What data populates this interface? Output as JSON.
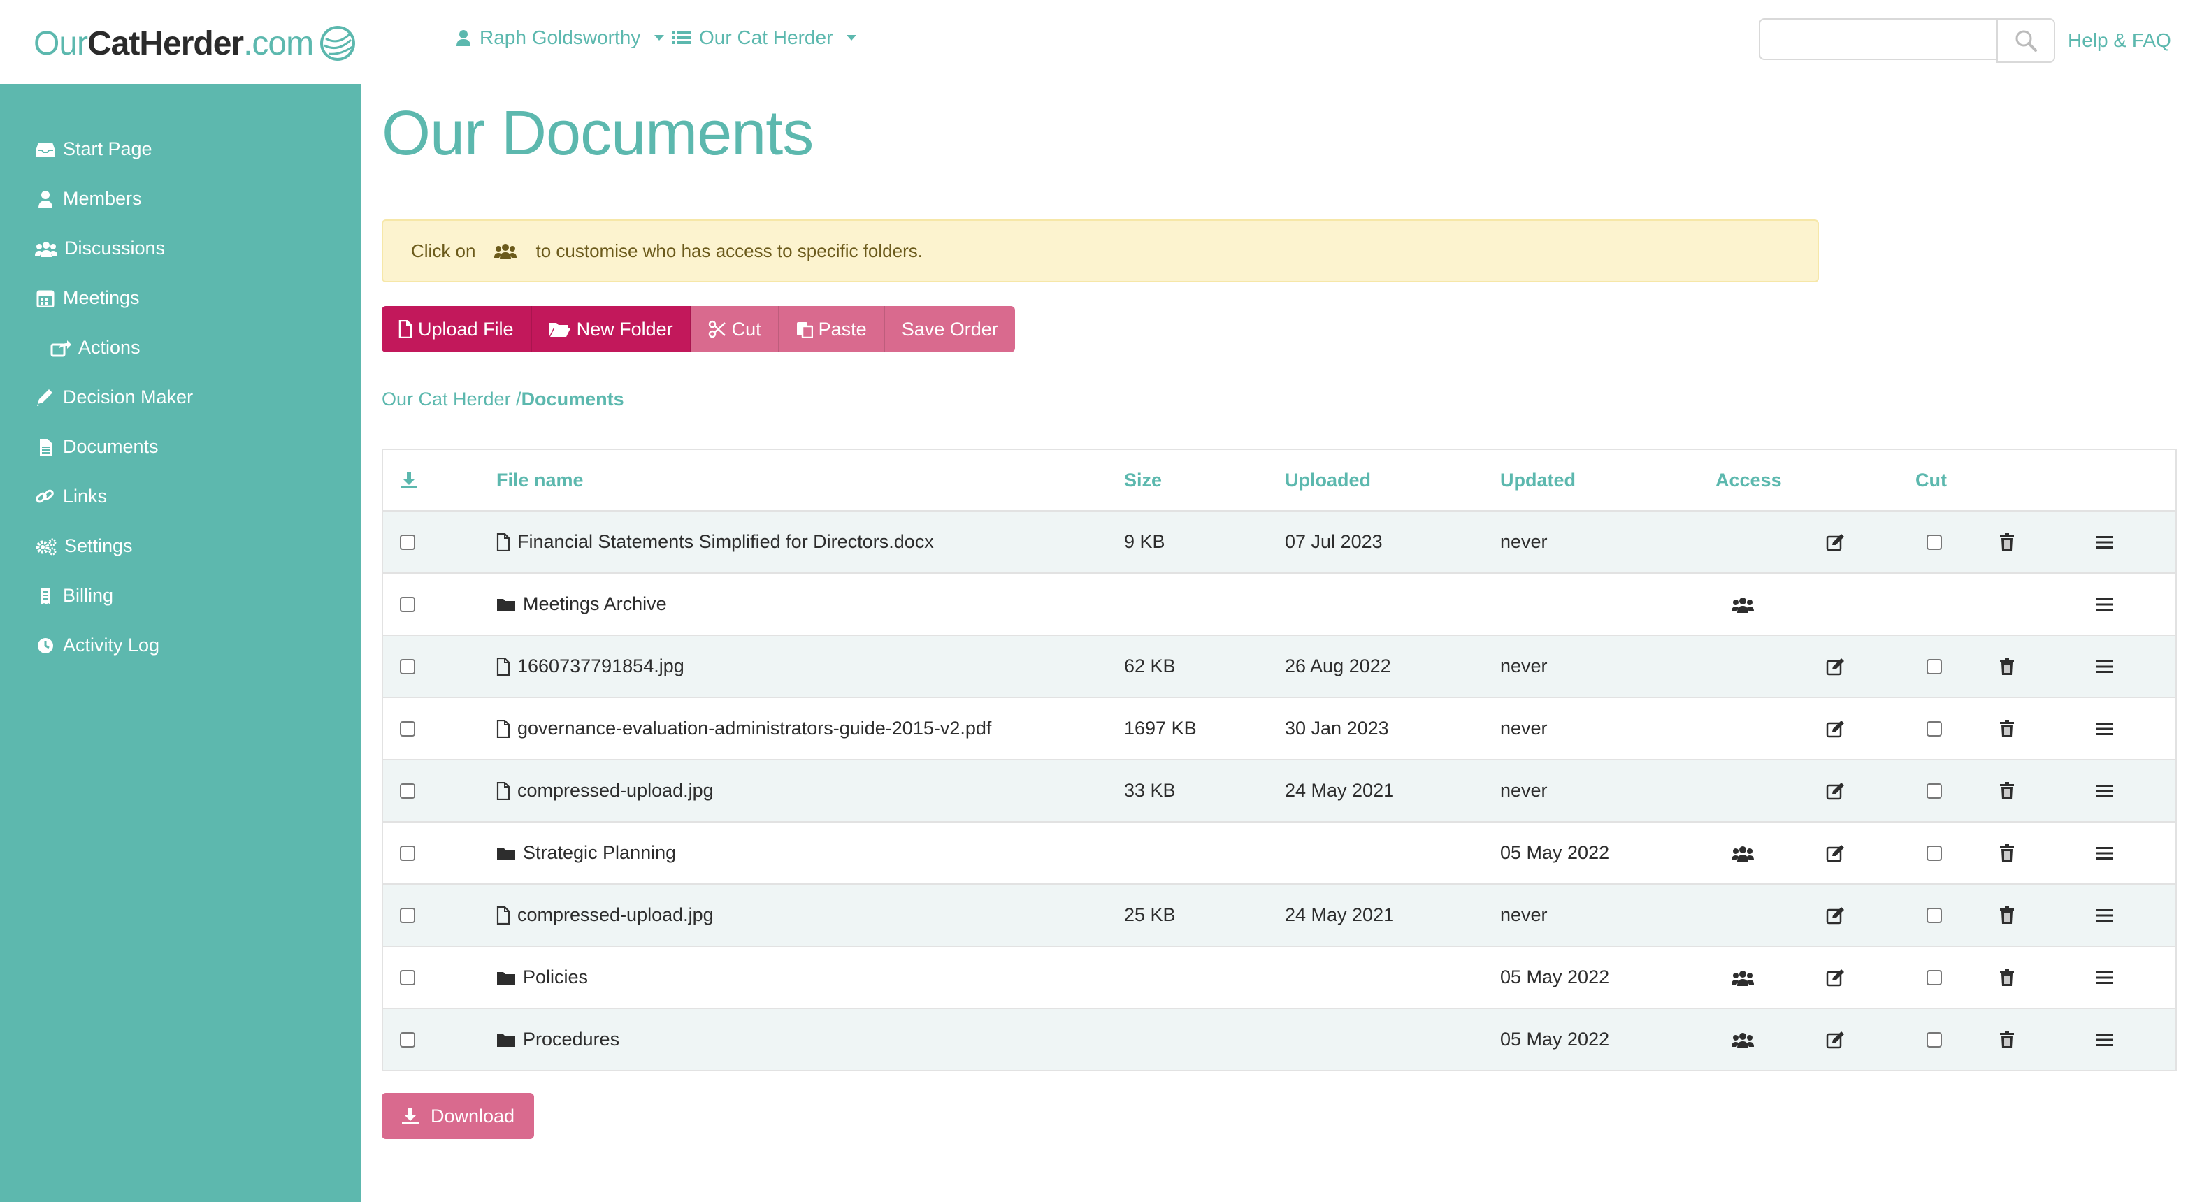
{
  "brand": {
    "part1": "Our",
    "part2": "CatHerder",
    "part3": ".com"
  },
  "topnav": {
    "user": "Raph Goldsworthy",
    "org": "Our Cat Herder",
    "help": "Help & FAQ",
    "search_placeholder": ""
  },
  "sidebar": {
    "items": [
      {
        "label": "Start Page",
        "icon": "inbox-icon"
      },
      {
        "label": "Members",
        "icon": "user-icon"
      },
      {
        "label": "Discussions",
        "icon": "users-icon"
      },
      {
        "label": "Meetings",
        "icon": "calendar-icon"
      },
      {
        "label": "Actions",
        "icon": "share-icon"
      },
      {
        "label": "Decision Maker",
        "icon": "pencil-icon"
      },
      {
        "label": "Documents",
        "icon": "file-icon"
      },
      {
        "label": "Links",
        "icon": "link-icon"
      },
      {
        "label": "Settings",
        "icon": "cogs-icon"
      },
      {
        "label": "Billing",
        "icon": "receipt-icon"
      },
      {
        "label": "Activity Log",
        "icon": "clock-icon"
      }
    ]
  },
  "page": {
    "title": "Our Documents"
  },
  "alert": {
    "prefix": "Click on",
    "suffix": "to customise who has access to specific folders."
  },
  "toolbar": {
    "upload": "Upload File",
    "new_folder": "New Folder",
    "cut": "Cut",
    "paste": "Paste",
    "save_order": "Save Order"
  },
  "breadcrumb": {
    "root": "Our Cat Herder /",
    "current": "Documents"
  },
  "table": {
    "headers": {
      "filename": "File name",
      "size": "Size",
      "uploaded": "Uploaded",
      "updated": "Updated",
      "access": "Access",
      "cut": "Cut"
    },
    "rows": [
      {
        "type": "file",
        "name": "Financial Statements Simplified for Directors.docx",
        "size": "9 KB",
        "uploaded": "07 Jul 2023",
        "updated": "never",
        "access": false,
        "edit": true,
        "cut": true,
        "delete": true
      },
      {
        "type": "folder",
        "name": "Meetings Archive",
        "size": "",
        "uploaded": "",
        "updated": "",
        "access": true,
        "edit": false,
        "cut": false,
        "delete": false
      },
      {
        "type": "file",
        "name": "1660737791854.jpg",
        "size": "62 KB",
        "uploaded": "26 Aug 2022",
        "updated": "never",
        "access": false,
        "edit": true,
        "cut": true,
        "delete": true
      },
      {
        "type": "file",
        "name": "governance-evaluation-administrators-guide-2015-v2.pdf",
        "size": "1697 KB",
        "uploaded": "30 Jan 2023",
        "updated": "never",
        "access": false,
        "edit": true,
        "cut": true,
        "delete": true
      },
      {
        "type": "file",
        "name": "compressed-upload.jpg",
        "size": "33 KB",
        "uploaded": "24 May 2021",
        "updated": "never",
        "access": false,
        "edit": true,
        "cut": true,
        "delete": true
      },
      {
        "type": "folder",
        "name": "Strategic Planning",
        "size": "",
        "uploaded": "",
        "updated": "05 May 2022",
        "access": true,
        "edit": true,
        "cut": true,
        "delete": true
      },
      {
        "type": "file",
        "name": "compressed-upload.jpg",
        "size": "25 KB",
        "uploaded": "24 May 2021",
        "updated": "never",
        "access": false,
        "edit": true,
        "cut": true,
        "delete": true
      },
      {
        "type": "folder",
        "name": "Policies",
        "size": "",
        "uploaded": "",
        "updated": "05 May 2022",
        "access": true,
        "edit": true,
        "cut": true,
        "delete": true
      },
      {
        "type": "folder",
        "name": "Procedures",
        "size": "",
        "uploaded": "",
        "updated": "05 May 2022",
        "access": true,
        "edit": true,
        "cut": true,
        "delete": true
      }
    ]
  },
  "download": {
    "label": "Download"
  },
  "colors": {
    "teal": "#5db8ae",
    "crimson": "#c2185b",
    "pink": "#d96a8e",
    "alert_bg": "#fcf3cf"
  }
}
